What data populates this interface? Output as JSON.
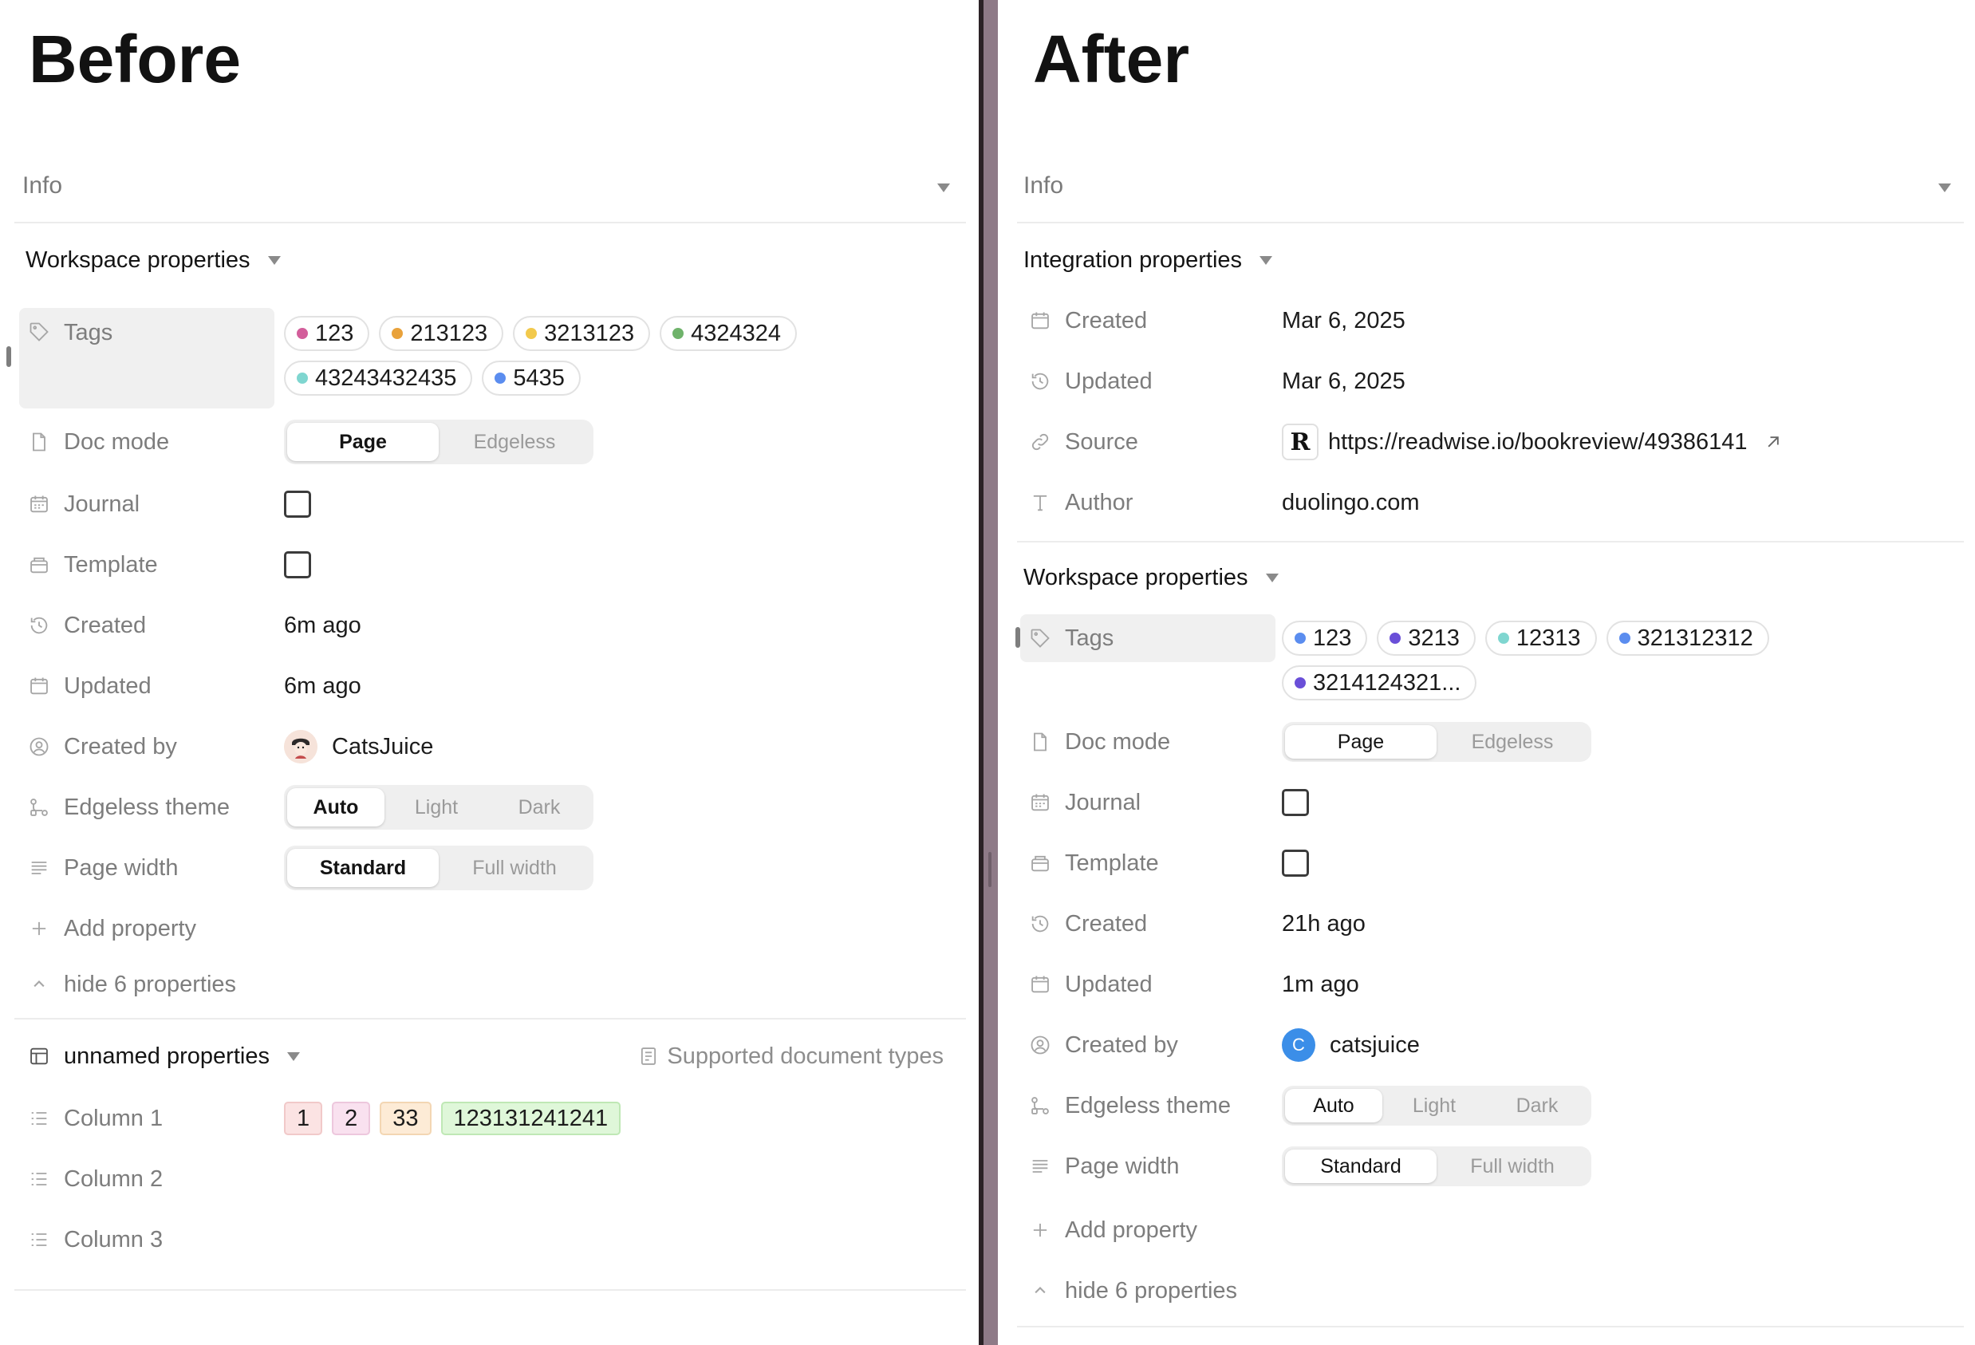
{
  "before": {
    "title": "Before",
    "info_label": "Info",
    "workspace_section": "Workspace properties",
    "tags_label": "Tags",
    "tags": [
      {
        "label": "123",
        "color": "#d35e9b"
      },
      {
        "label": "213123",
        "color": "#e9a23b"
      },
      {
        "label": "3213123",
        "color": "#f2c94c"
      },
      {
        "label": "4324324",
        "color": "#6fb36b"
      },
      {
        "label": "43243432435",
        "color": "#7fd6d0"
      },
      {
        "label": "5435",
        "color": "#5b8def"
      }
    ],
    "doc_mode_label": "Doc mode",
    "doc_mode_options": [
      "Page",
      "Edgeless"
    ],
    "journal_label": "Journal",
    "template_label": "Template",
    "created_label": "Created",
    "created_value": "6m ago",
    "updated_label": "Updated",
    "updated_value": "6m ago",
    "created_by_label": "Created by",
    "created_by_value": "CatsJuice",
    "edgeless_theme_label": "Edgeless theme",
    "edgeless_theme_options": [
      "Auto",
      "Light",
      "Dark"
    ],
    "page_width_label": "Page width",
    "page_width_options": [
      "Standard",
      "Full width"
    ],
    "add_property": "Add property",
    "hide_properties": "hide 6 properties",
    "unnamed_section": "unnamed properties",
    "supported_types": "Supported document types",
    "columns": [
      {
        "label": "Column 1",
        "chips": [
          {
            "label": "1",
            "bg": "#fbe3e3",
            "border": "#f1c9c9"
          },
          {
            "label": "2",
            "bg": "#f9e1ef",
            "border": "#edc7dd"
          },
          {
            "label": "33",
            "bg": "#fdebd6",
            "border": "#f3d6b3"
          },
          {
            "label": "123131241241",
            "bg": "#dff7d9",
            "border": "#bfe8b5"
          }
        ]
      },
      {
        "label": "Column 2",
        "chips": []
      },
      {
        "label": "Column 3",
        "chips": []
      }
    ]
  },
  "after": {
    "title": "After",
    "info_label": "Info",
    "integration_section": "Integration properties",
    "integration": {
      "created_label": "Created",
      "created_value": "Mar 6, 2025",
      "updated_label": "Updated",
      "updated_value": "Mar 6, 2025",
      "source_label": "Source",
      "source_logo": "R",
      "source_value": "https://readwise.io/bookreview/49386141",
      "author_label": "Author",
      "author_value": "duolingo.com"
    },
    "workspace_section": "Workspace properties",
    "tags_label": "Tags",
    "tags": [
      {
        "label": "123",
        "color": "#5b8def"
      },
      {
        "label": "3213",
        "color": "#6a4fd8"
      },
      {
        "label": "12313",
        "color": "#7fd6d0"
      },
      {
        "label": "321312312",
        "color": "#5b8def"
      },
      {
        "label": "3214124321...",
        "color": "#6a4fd8"
      }
    ],
    "doc_mode_label": "Doc mode",
    "doc_mode_options": [
      "Page",
      "Edgeless"
    ],
    "journal_label": "Journal",
    "template_label": "Template",
    "created_label": "Created",
    "created_value": "21h ago",
    "updated_label": "Updated",
    "updated_value": "1m ago",
    "created_by_label": "Created by",
    "created_by_initial": "C",
    "created_by_value": "catsjuice",
    "edgeless_theme_label": "Edgeless theme",
    "edgeless_theme_options": [
      "Auto",
      "Light",
      "Dark"
    ],
    "page_width_label": "Page width",
    "page_width_options": [
      "Standard",
      "Full width"
    ],
    "add_property": "Add property",
    "hide_properties": "hide 6 properties"
  },
  "colors": {
    "divider_dark": "#2b2226",
    "divider_mauve": "#8e7a87",
    "avatar_blue": "#3b8ee8"
  }
}
